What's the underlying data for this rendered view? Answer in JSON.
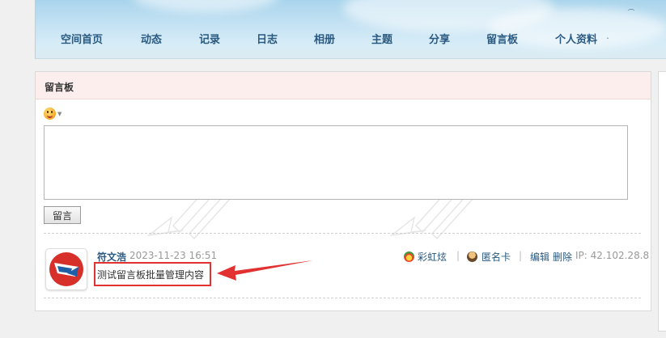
{
  "nav": {
    "items": [
      {
        "label": "空间首页"
      },
      {
        "label": "动态"
      },
      {
        "label": "记录"
      },
      {
        "label": "日志"
      },
      {
        "label": "相册"
      },
      {
        "label": "主题"
      },
      {
        "label": "分享"
      },
      {
        "label": "留言板"
      },
      {
        "label": "个人资料"
      }
    ]
  },
  "panel": {
    "title": "留言板",
    "textarea_value": "",
    "submit_label": "留言"
  },
  "comment": {
    "author": "符文浩",
    "timestamp": "2023-11-23 16:51",
    "text": "测试留言板批量管理内容",
    "actions": {
      "rainbow_label": "彩虹炫",
      "anon_card_label": "匿名卡",
      "edit_label": "编辑",
      "delete_label": "删除",
      "ip_label": "IP: 42.102.28.8",
      "separator": "|"
    }
  },
  "colors": {
    "link_blue": "#2a5a82",
    "header_pink": "#fdeeee",
    "highlight_red": "#e23131"
  }
}
